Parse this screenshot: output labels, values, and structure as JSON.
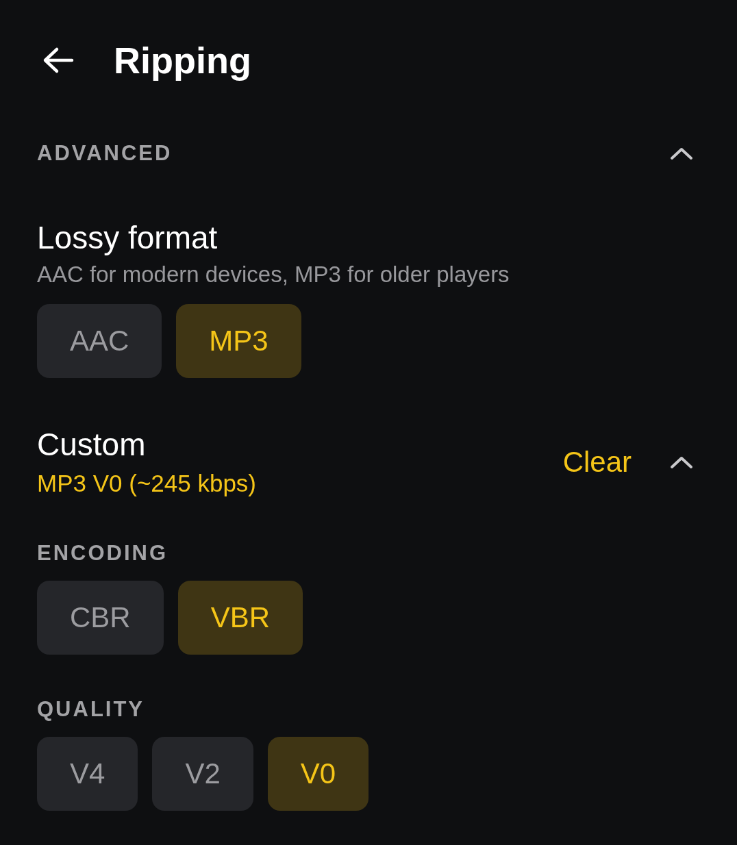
{
  "header": {
    "title": "Ripping"
  },
  "advanced": {
    "heading": "ADVANCED",
    "expanded": true,
    "lossy_format": {
      "title": "Lossy format",
      "description": "AAC for modern devices, MP3 for older players",
      "options": [
        {
          "label": "AAC",
          "selected": false
        },
        {
          "label": "MP3",
          "selected": true
        }
      ]
    },
    "custom": {
      "title": "Custom",
      "summary": "MP3 V0 (~245 kbps)",
      "action": "Clear",
      "expanded": true,
      "groups": [
        {
          "heading": "ENCODING",
          "options": [
            {
              "label": "CBR",
              "selected": false
            },
            {
              "label": "VBR",
              "selected": true
            }
          ]
        },
        {
          "heading": "QUALITY",
          "options": [
            {
              "label": "V4",
              "selected": false
            },
            {
              "label": "V2",
              "selected": false
            },
            {
              "label": "V0",
              "selected": true
            }
          ]
        }
      ]
    }
  }
}
